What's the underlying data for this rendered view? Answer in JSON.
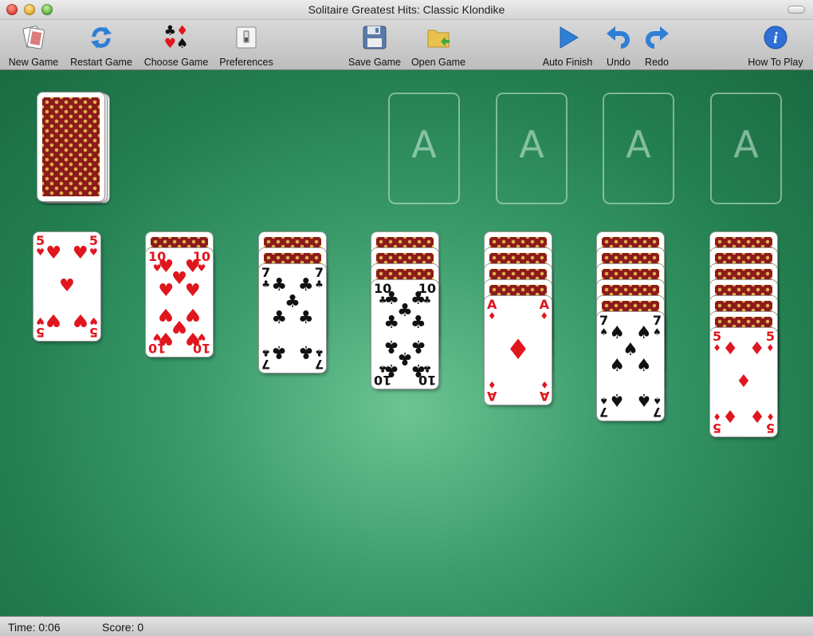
{
  "window": {
    "title": "Solitaire Greatest Hits: Classic Klondike"
  },
  "toolbar": {
    "new_game": "New Game",
    "restart_game": "Restart Game",
    "choose_game": "Choose Game",
    "preferences": "Preferences",
    "save_game": "Save Game",
    "open_game": "Open Game",
    "auto_finish": "Auto Finish",
    "undo": "Undo",
    "redo": "Redo",
    "how_to_play": "How To Play"
  },
  "foundations": [
    "A",
    "A",
    "A",
    "A"
  ],
  "tableau": [
    {
      "hidden": 0,
      "rank": "5",
      "suit": "hearts",
      "color": "red"
    },
    {
      "hidden": 1,
      "rank": "10",
      "suit": "hearts",
      "color": "red"
    },
    {
      "hidden": 2,
      "rank": "7",
      "suit": "clubs",
      "color": "black"
    },
    {
      "hidden": 3,
      "rank": "10",
      "suit": "clubs",
      "color": "black"
    },
    {
      "hidden": 4,
      "rank": "A",
      "suit": "diamonds",
      "color": "red"
    },
    {
      "hidden": 5,
      "rank": "7",
      "suit": "spades",
      "color": "black"
    },
    {
      "hidden": 6,
      "rank": "5",
      "suit": "diamonds",
      "color": "red"
    }
  ],
  "status": {
    "time": "Time: 0:06",
    "score": "Score: 0"
  },
  "colors": {
    "felt": "#2a8a5a",
    "card_back": "#8b1a1a",
    "red_suit": "#e0161e"
  }
}
